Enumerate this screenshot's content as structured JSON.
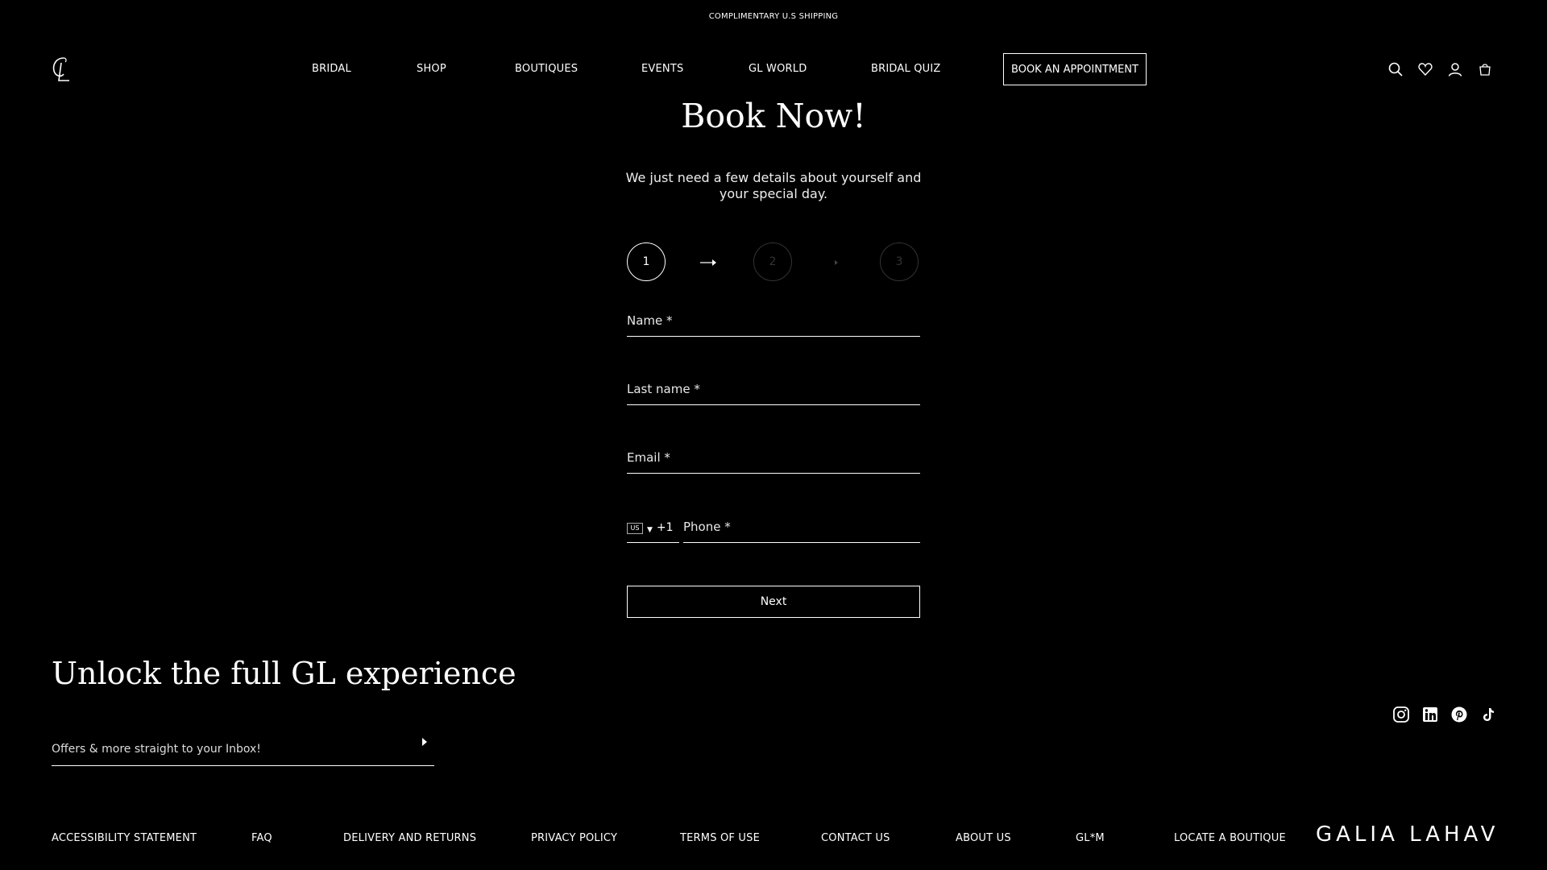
{
  "announcement": "COMPLIMENTARY U.S SHIPPING",
  "header": {
    "logo_alt": "GL",
    "nav": [
      "BRIDAL",
      "SHOP",
      "BOUTIQUES",
      "EVENTS",
      "GL WORLD",
      "BRIDAL QUIZ"
    ],
    "book_button": "BOOK AN APPOINTMENT",
    "icons": [
      "search-icon",
      "heart-icon",
      "user-icon",
      "bag-icon"
    ]
  },
  "form": {
    "title": "Book Now!",
    "subtitle": "We just need a few details about yourself and your special day.",
    "steps": [
      "1",
      "2",
      "3"
    ],
    "current_step": 1,
    "fields": {
      "name": "Name *",
      "last_name": "Last name *",
      "email": "Email *",
      "phone": "Phone *"
    },
    "phone_code": "+1",
    "next_button": "Next"
  },
  "newsletter": {
    "title": "Unlock the full GL experience",
    "placeholder": "Offers & more straight to your Inbox!"
  },
  "social": [
    "instagram-icon",
    "linkedin-icon",
    "pinterest-icon",
    "tiktok-icon"
  ],
  "footer": {
    "links": [
      "ACCESSIBILITY STATEMENT",
      "FAQ",
      "DELIVERY AND RETURNS",
      "PRIVACY POLICY",
      "TERMS OF USE",
      "CONTACT US",
      "ABOUT US",
      "GL*M",
      "LOCATE A BOUTIQUE"
    ],
    "brand": "GALIA LAHAV"
  },
  "colors": {
    "background": "#000000",
    "foreground": "#ffffff",
    "inactive_step": "#333333"
  }
}
